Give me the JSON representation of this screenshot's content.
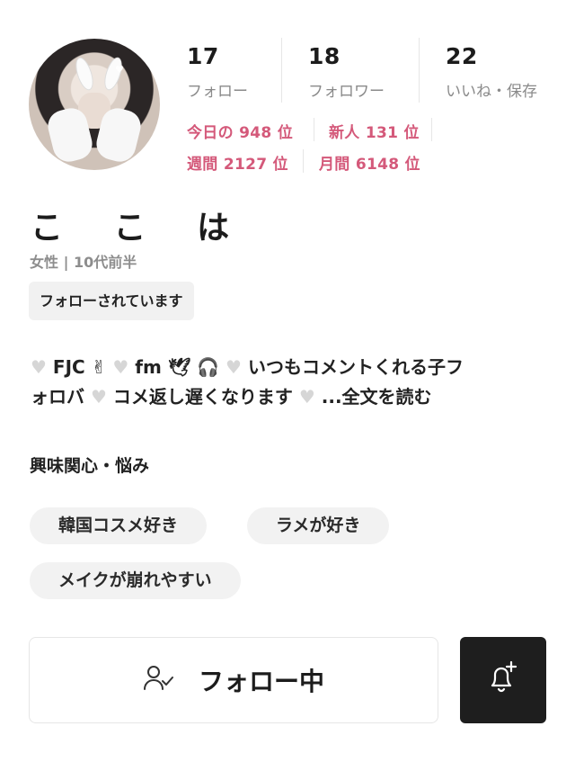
{
  "profile": {
    "name": "こ こ は",
    "meta": "女性 | 10代前半",
    "follow_status_badge": "フォローされています"
  },
  "stats": [
    {
      "value": "17",
      "label": "フォロー"
    },
    {
      "value": "18",
      "label": "フォロワー"
    },
    {
      "value": "22",
      "label": "いいね・保存"
    }
  ],
  "rankings": {
    "today": "今日の 948 位",
    "new": "新人 131 位",
    "weekly": "週間 2127 位",
    "monthly": "月間 6148 位"
  },
  "bio": {
    "line1_a": "FJC",
    "line1_b": "fm",
    "line1_c": "いつもコメントくれる子フ",
    "line2_a": "ォロバ",
    "line2_b": "コメ返し遅くなります",
    "read_more": "...全文を読む"
  },
  "interests": {
    "title": "興味関心・悩み",
    "tags": [
      "韓国コスメ好き",
      "ラメが好き",
      "メイクが崩れやすい"
    ]
  },
  "actions": {
    "follow_label": "フォロー中"
  },
  "colors": {
    "rank": "#d4597a",
    "bell_button_bg": "#1e1e1e",
    "tag_bg": "#f2f2f2"
  },
  "icons": [
    "heart-icon",
    "hand-emoji-icon",
    "dove-emoji-icon",
    "headphones-emoji-icon",
    "user-check-icon",
    "bell-plus-icon"
  ]
}
